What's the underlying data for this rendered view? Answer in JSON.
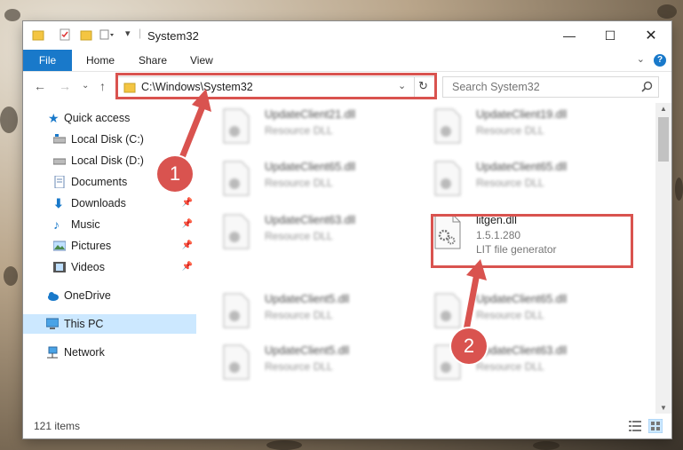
{
  "window": {
    "title": "System32"
  },
  "ribbon": {
    "tabs": [
      "File",
      "Home",
      "Share",
      "View"
    ],
    "help_label": "?"
  },
  "nav": {
    "address": "C:\\Windows\\System32",
    "search_placeholder": "Search System32"
  },
  "sidebar": {
    "items": [
      {
        "label": "Quick access",
        "icon": "star-icon",
        "pinned": false
      },
      {
        "label": "Local Disk (C:)",
        "icon": "drive-icon",
        "pinned": false
      },
      {
        "label": "Local Disk (D:)",
        "icon": "drive-icon",
        "pinned": false
      },
      {
        "label": "Documents",
        "icon": "documents-icon",
        "pinned": true
      },
      {
        "label": "Downloads",
        "icon": "downloads-icon",
        "pinned": true
      },
      {
        "label": "Music",
        "icon": "music-icon",
        "pinned": true
      },
      {
        "label": "Pictures",
        "icon": "pictures-icon",
        "pinned": true
      },
      {
        "label": "Videos",
        "icon": "videos-icon",
        "pinned": true
      },
      {
        "label": "OneDrive",
        "icon": "cloud-icon",
        "pinned": false
      },
      {
        "label": "This PC",
        "icon": "pc-icon",
        "pinned": false,
        "selected": true
      },
      {
        "label": "Network",
        "icon": "network-icon",
        "pinned": false
      }
    ]
  },
  "files": [
    {
      "name": "UpdateClient21.dll",
      "desc": "Resource DLL",
      "blurred": true
    },
    {
      "name": "UpdateClient19.dll",
      "desc": "Resource DLL",
      "blurred": true
    },
    {
      "name": "UpdateClient65.dll",
      "desc": "Resource DLL",
      "blurred": true
    },
    {
      "name": "UpdateClient65.dll",
      "desc": "Resource DLL",
      "blurred": true
    },
    {
      "name": "UpdateClient63.dll",
      "desc": "Resource DLL",
      "blurred": true
    },
    {
      "name": "litgen.dll",
      "version": "1.5.1.280",
      "desc": "LIT file generator",
      "blurred": false
    },
    {
      "name": "UpdateClient5.dll",
      "desc": "Resource DLL",
      "blurred": true
    },
    {
      "name": "UpdateClient65.dll",
      "desc": "Resource DLL",
      "blurred": true
    },
    {
      "name": "UpdateClient5.dll",
      "desc": "Resource DLL",
      "blurred": true
    },
    {
      "name": "UpdateClient63.dll",
      "desc": "Resource DLL",
      "blurred": true
    }
  ],
  "status": {
    "item_count": "121 items"
  },
  "annotations": {
    "step1": "1",
    "step2": "2",
    "color": "#d9534f"
  }
}
